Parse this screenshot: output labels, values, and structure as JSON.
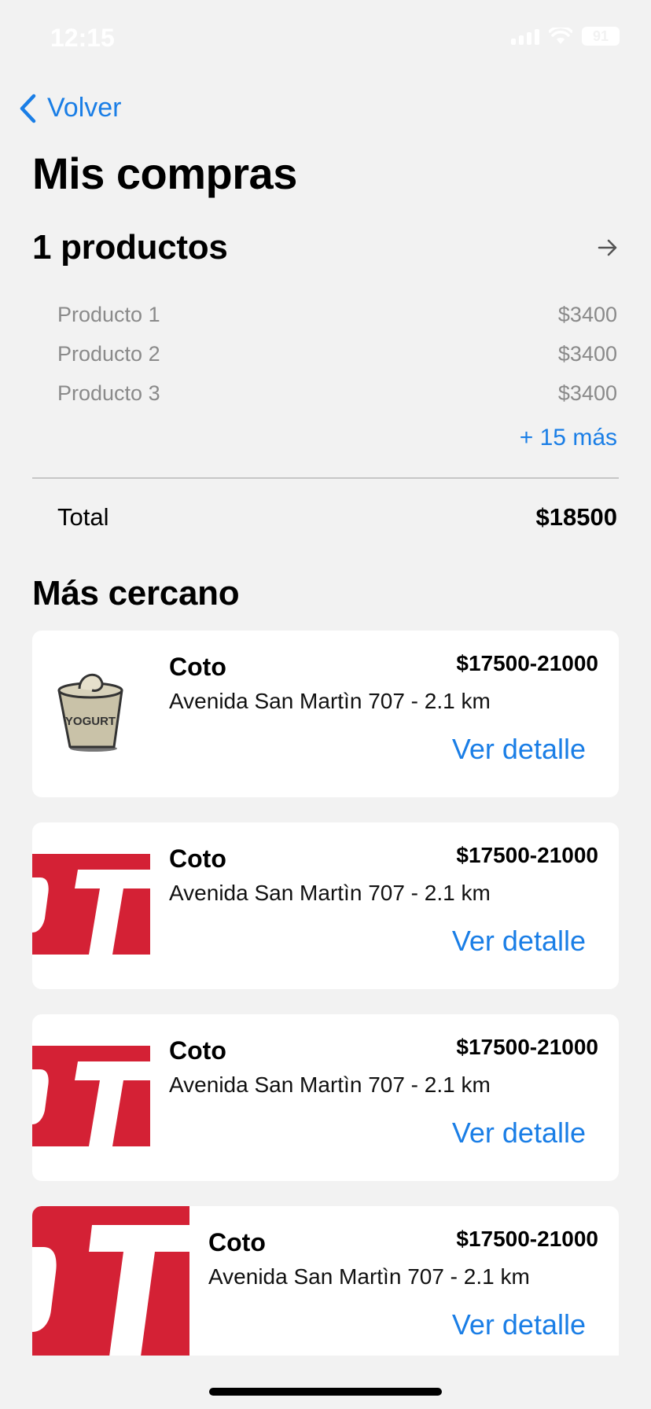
{
  "status_bar": {
    "time": "12:15",
    "battery": "91"
  },
  "nav": {
    "back_label": "Volver"
  },
  "page_title": "Mis compras",
  "products": {
    "count_label": "1 productos",
    "items": [
      {
        "name": "Producto 1",
        "price": "$3400"
      },
      {
        "name": "Producto 2",
        "price": "$3400"
      },
      {
        "name": "Producto 3",
        "price": "$3400"
      }
    ],
    "more_label": "+ 15 más",
    "total_label": "Total",
    "total_value": "$18500"
  },
  "section_title": "Más cercano",
  "stores": [
    {
      "name": "Coto",
      "price_range": "$17500-21000",
      "address": "Avenida San Martìn 707 - 2.1 km",
      "detail_label": "Ver detalle",
      "image": "yogurt-icon",
      "image_text": "YOGURT"
    },
    {
      "name": "Coto",
      "price_range": "$17500-21000",
      "address": "Avenida San Martìn 707 - 2.1 km",
      "detail_label": "Ver detalle",
      "image": "coto-logo"
    },
    {
      "name": "Coto",
      "price_range": "$17500-21000",
      "address": "Avenida San Martìn 707 - 2.1 km",
      "detail_label": "Ver detalle",
      "image": "coto-logo"
    },
    {
      "name": "Coto",
      "price_range": "$17500-21000",
      "address": "Avenida San Martìn 707 - 2.1 km",
      "detail_label": "Ver detalle",
      "image": "coto-logo"
    }
  ],
  "colors": {
    "accent": "#1a7ee6",
    "background": "#f2f2f2",
    "card": "#ffffff",
    "brand_red": "#d42135"
  }
}
